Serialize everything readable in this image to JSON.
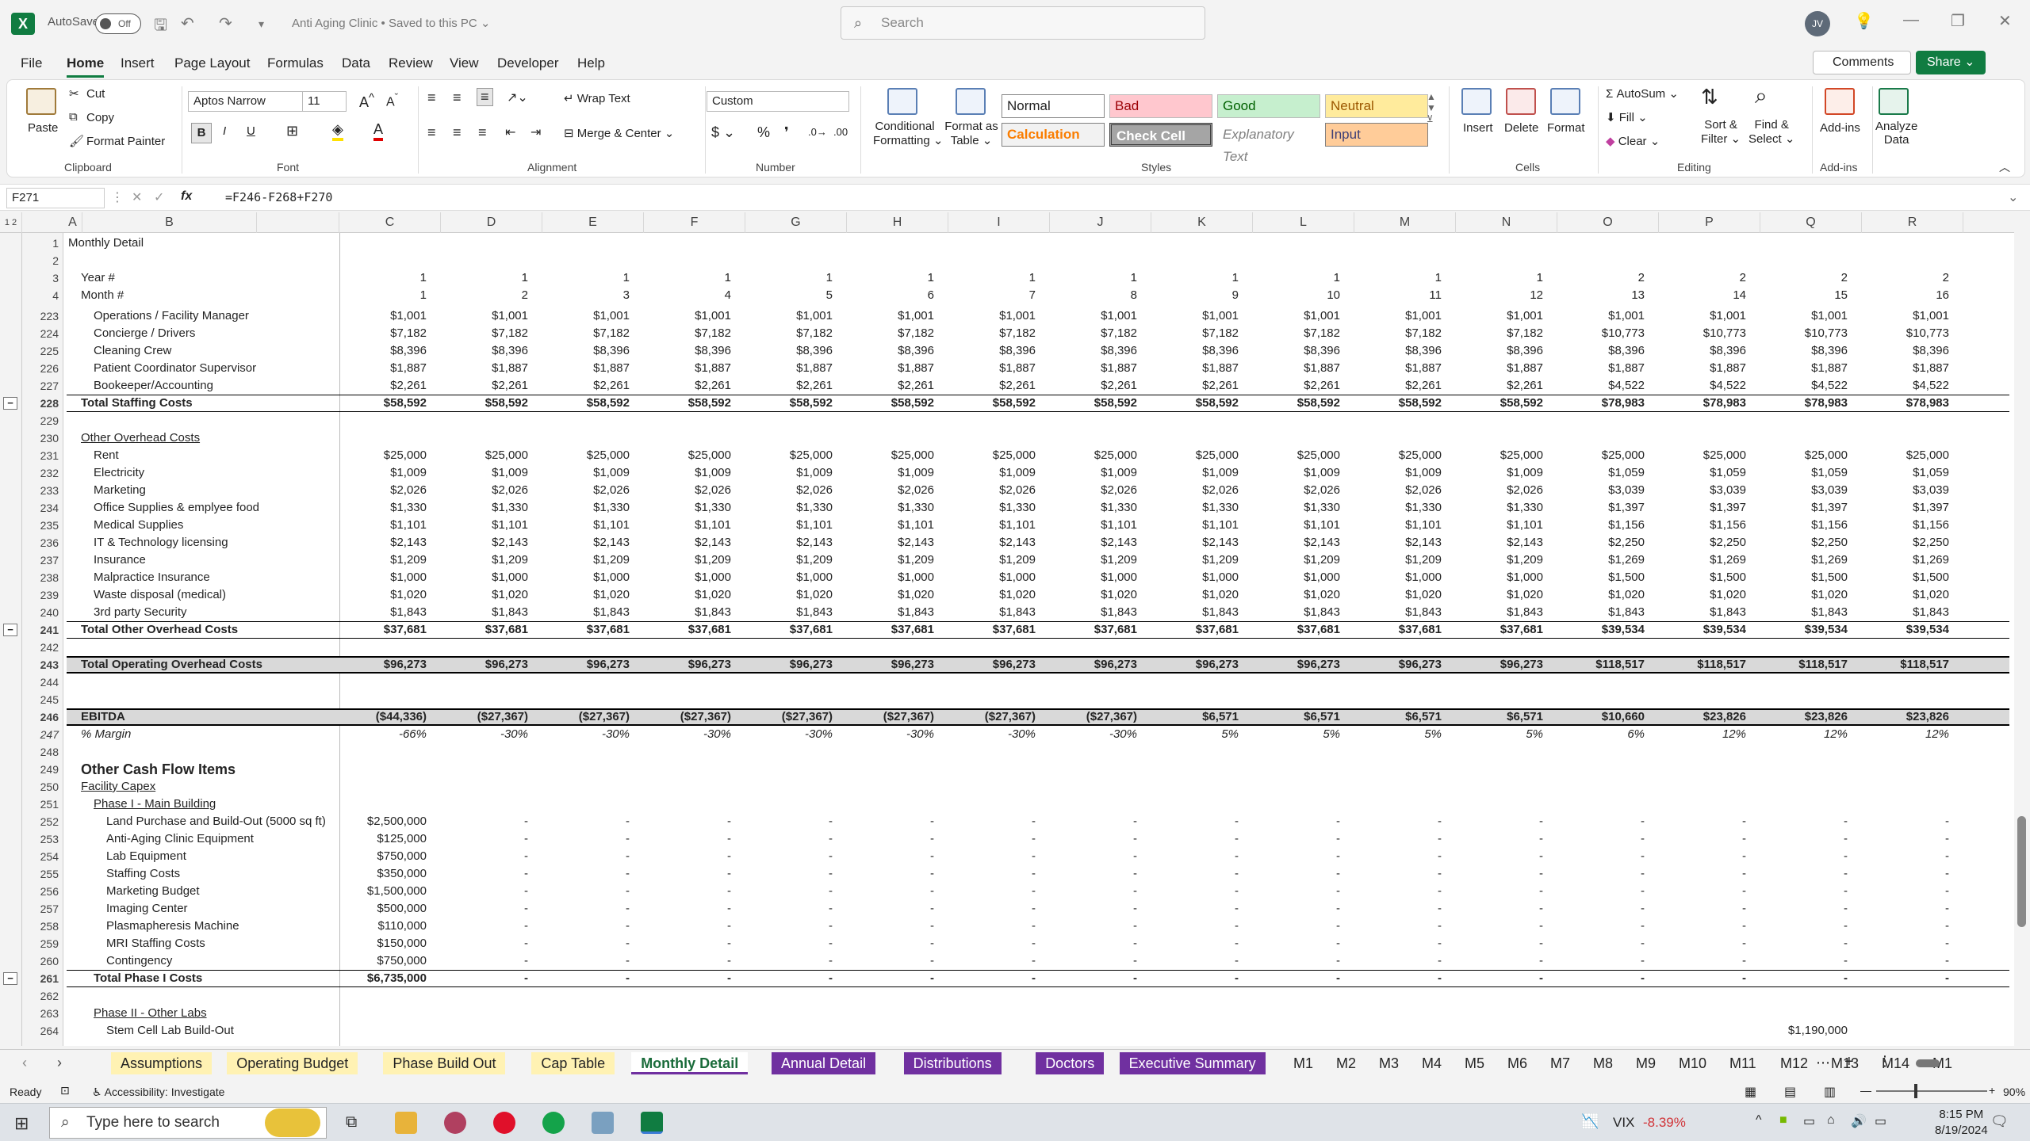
{
  "title": {
    "autosave": "AutoSave",
    "toggle": "Off",
    "doc": "Anti Aging Clinic • Saved to this PC ⌄",
    "search": "Search",
    "avatar": "JV"
  },
  "menu": [
    "File",
    "Home",
    "Insert",
    "Page Layout",
    "Formulas",
    "Data",
    "Review",
    "View",
    "Developer",
    "Help"
  ],
  "actions": {
    "comments": "Comments",
    "share": "Share ⌄"
  },
  "ribbon": {
    "paste": "Paste",
    "cut": "Cut",
    "copy": "Copy",
    "format_painter": "Format Painter",
    "clipboard": "Clipboard",
    "font_name": "Aptos Narrow",
    "font_size": "11",
    "font": "Font",
    "wrap_text": "Wrap Text",
    "merge_center": "Merge & Center",
    "alignment": "Alignment",
    "num_format": "Custom",
    "number": "Number",
    "conditional": "Conditional",
    "formatting": "Formatting ⌄",
    "format_as": "Format as",
    "table": "Table ⌄",
    "styles": "Styles",
    "normal": "Normal",
    "bad": "Bad",
    "good": "Good",
    "neutral": "Neutral",
    "calculation": "Calculation",
    "check_cell": "Check Cell",
    "explanatory": "Explanatory Text",
    "input": "Input",
    "insert": "Insert",
    "delete": "Delete",
    "format": "Format",
    "cells": "Cells",
    "autosum": "AutoSum",
    "fill": "Fill",
    "clear": "Clear",
    "sort": "Sort &",
    "filter": "Filter ⌄",
    "find": "Find &",
    "select": "Select ⌄",
    "editing": "Editing",
    "addins": "Add-ins",
    "addins_grp": "Add-ins",
    "analyze": "Analyze",
    "data": "Data"
  },
  "formula": {
    "namebox": "F271",
    "fx": "fx",
    "text": "=F246-F268+F270"
  },
  "columns": [
    "A",
    "B",
    "C",
    "D",
    "E",
    "F",
    "G",
    "H",
    "I",
    "J",
    "K",
    "L",
    "M",
    "N",
    "O",
    "P",
    "Q",
    "R"
  ],
  "rows": [
    {
      "n": "1",
      "label": "Monthly Detail",
      "ind": 0,
      "style": "bold",
      "vals": []
    },
    {
      "n": "2",
      "label": "",
      "ind": 0,
      "style": "",
      "vals": []
    },
    {
      "n": "3",
      "label": "Year #",
      "ind": 1,
      "style": "",
      "vals": [
        "1",
        "1",
        "1",
        "1",
        "1",
        "1",
        "1",
        "1",
        "1",
        "1",
        "1",
        "1",
        "2",
        "2",
        "2",
        "2"
      ]
    },
    {
      "n": "4",
      "label": "Month #",
      "ind": 1,
      "style": "",
      "vals": [
        "1",
        "2",
        "3",
        "4",
        "5",
        "6",
        "7",
        "8",
        "9",
        "10",
        "11",
        "12",
        "13",
        "14",
        "15",
        "16"
      ]
    },
    {
      "n": "223",
      "label": "Operations / Facility Manager",
      "ind": 2,
      "style": "",
      "vals": [
        "$1,001",
        "$1,001",
        "$1,001",
        "$1,001",
        "$1,001",
        "$1,001",
        "$1,001",
        "$1,001",
        "$1,001",
        "$1,001",
        "$1,001",
        "$1,001",
        "$1,001",
        "$1,001",
        "$1,001",
        "$1,001"
      ]
    },
    {
      "n": "224",
      "label": "Concierge / Drivers",
      "ind": 2,
      "style": "",
      "vals": [
        "$7,182",
        "$7,182",
        "$7,182",
        "$7,182",
        "$7,182",
        "$7,182",
        "$7,182",
        "$7,182",
        "$7,182",
        "$7,182",
        "$7,182",
        "$7,182",
        "$10,773",
        "$10,773",
        "$10,773",
        "$10,773"
      ]
    },
    {
      "n": "225",
      "label": "Cleaning Crew",
      "ind": 2,
      "style": "",
      "vals": [
        "$8,396",
        "$8,396",
        "$8,396",
        "$8,396",
        "$8,396",
        "$8,396",
        "$8,396",
        "$8,396",
        "$8,396",
        "$8,396",
        "$8,396",
        "$8,396",
        "$8,396",
        "$8,396",
        "$8,396",
        "$8,396"
      ]
    },
    {
      "n": "226",
      "label": "Patient Coordinator Supervisor",
      "ind": 2,
      "style": "",
      "vals": [
        "$1,887",
        "$1,887",
        "$1,887",
        "$1,887",
        "$1,887",
        "$1,887",
        "$1,887",
        "$1,887",
        "$1,887",
        "$1,887",
        "$1,887",
        "$1,887",
        "$1,887",
        "$1,887",
        "$1,887",
        "$1,887"
      ]
    },
    {
      "n": "227",
      "label": "Bookeeper/Accounting",
      "ind": 2,
      "style": "",
      "vals": [
        "$2,261",
        "$2,261",
        "$2,261",
        "$2,261",
        "$2,261",
        "$2,261",
        "$2,261",
        "$2,261",
        "$2,261",
        "$2,261",
        "$2,261",
        "$2,261",
        "$4,522",
        "$4,522",
        "$4,522",
        "$4,522"
      ]
    },
    {
      "n": "228",
      "label": "Total Staffing Costs",
      "ind": 1,
      "style": "total",
      "vals": [
        "$58,592",
        "$58,592",
        "$58,592",
        "$58,592",
        "$58,592",
        "$58,592",
        "$58,592",
        "$58,592",
        "$58,592",
        "$58,592",
        "$58,592",
        "$58,592",
        "$78,983",
        "$78,983",
        "$78,983",
        "$78,983"
      ]
    },
    {
      "n": "229",
      "label": "",
      "ind": 0,
      "style": "",
      "vals": []
    },
    {
      "n": "230",
      "label": "Other Overhead Costs",
      "ind": 1,
      "style": "under",
      "vals": []
    },
    {
      "n": "231",
      "label": "Rent",
      "ind": 2,
      "style": "",
      "vals": [
        "$25,000",
        "$25,000",
        "$25,000",
        "$25,000",
        "$25,000",
        "$25,000",
        "$25,000",
        "$25,000",
        "$25,000",
        "$25,000",
        "$25,000",
        "$25,000",
        "$25,000",
        "$25,000",
        "$25,000",
        "$25,000"
      ]
    },
    {
      "n": "232",
      "label": "Electricity",
      "ind": 2,
      "style": "",
      "vals": [
        "$1,009",
        "$1,009",
        "$1,009",
        "$1,009",
        "$1,009",
        "$1,009",
        "$1,009",
        "$1,009",
        "$1,009",
        "$1,009",
        "$1,009",
        "$1,009",
        "$1,059",
        "$1,059",
        "$1,059",
        "$1,059"
      ]
    },
    {
      "n": "233",
      "label": "Marketing",
      "ind": 2,
      "style": "",
      "vals": [
        "$2,026",
        "$2,026",
        "$2,026",
        "$2,026",
        "$2,026",
        "$2,026",
        "$2,026",
        "$2,026",
        "$2,026",
        "$2,026",
        "$2,026",
        "$2,026",
        "$3,039",
        "$3,039",
        "$3,039",
        "$3,039"
      ]
    },
    {
      "n": "234",
      "label": "Office Supplies & emplyee food",
      "ind": 2,
      "style": "",
      "vals": [
        "$1,330",
        "$1,330",
        "$1,330",
        "$1,330",
        "$1,330",
        "$1,330",
        "$1,330",
        "$1,330",
        "$1,330",
        "$1,330",
        "$1,330",
        "$1,330",
        "$1,397",
        "$1,397",
        "$1,397",
        "$1,397"
      ]
    },
    {
      "n": "235",
      "label": "Medical Supplies",
      "ind": 2,
      "style": "",
      "vals": [
        "$1,101",
        "$1,101",
        "$1,101",
        "$1,101",
        "$1,101",
        "$1,101",
        "$1,101",
        "$1,101",
        "$1,101",
        "$1,101",
        "$1,101",
        "$1,101",
        "$1,156",
        "$1,156",
        "$1,156",
        "$1,156"
      ]
    },
    {
      "n": "236",
      "label": "IT & Technology licensing",
      "ind": 2,
      "style": "",
      "vals": [
        "$2,143",
        "$2,143",
        "$2,143",
        "$2,143",
        "$2,143",
        "$2,143",
        "$2,143",
        "$2,143",
        "$2,143",
        "$2,143",
        "$2,143",
        "$2,143",
        "$2,250",
        "$2,250",
        "$2,250",
        "$2,250"
      ]
    },
    {
      "n": "237",
      "label": "Insurance",
      "ind": 2,
      "style": "",
      "vals": [
        "$1,209",
        "$1,209",
        "$1,209",
        "$1,209",
        "$1,209",
        "$1,209",
        "$1,209",
        "$1,209",
        "$1,209",
        "$1,209",
        "$1,209",
        "$1,209",
        "$1,269",
        "$1,269",
        "$1,269",
        "$1,269"
      ]
    },
    {
      "n": "238",
      "label": "Malpractice Insurance",
      "ind": 2,
      "style": "",
      "vals": [
        "$1,000",
        "$1,000",
        "$1,000",
        "$1,000",
        "$1,000",
        "$1,000",
        "$1,000",
        "$1,000",
        "$1,000",
        "$1,000",
        "$1,000",
        "$1,000",
        "$1,500",
        "$1,500",
        "$1,500",
        "$1,500"
      ]
    },
    {
      "n": "239",
      "label": "Waste disposal (medical)",
      "ind": 2,
      "style": "",
      "vals": [
        "$1,020",
        "$1,020",
        "$1,020",
        "$1,020",
        "$1,020",
        "$1,020",
        "$1,020",
        "$1,020",
        "$1,020",
        "$1,020",
        "$1,020",
        "$1,020",
        "$1,020",
        "$1,020",
        "$1,020",
        "$1,020"
      ]
    },
    {
      "n": "240",
      "label": "3rd party Security",
      "ind": 2,
      "style": "",
      "vals": [
        "$1,843",
        "$1,843",
        "$1,843",
        "$1,843",
        "$1,843",
        "$1,843",
        "$1,843",
        "$1,843",
        "$1,843",
        "$1,843",
        "$1,843",
        "$1,843",
        "$1,843",
        "$1,843",
        "$1,843",
        "$1,843"
      ]
    },
    {
      "n": "241",
      "label": "Total Other Overhead Costs",
      "ind": 1,
      "style": "total",
      "vals": [
        "$37,681",
        "$37,681",
        "$37,681",
        "$37,681",
        "$37,681",
        "$37,681",
        "$37,681",
        "$37,681",
        "$37,681",
        "$37,681",
        "$37,681",
        "$37,681",
        "$39,534",
        "$39,534",
        "$39,534",
        "$39,534"
      ]
    },
    {
      "n": "242",
      "label": "",
      "ind": 0,
      "style": "",
      "vals": []
    },
    {
      "n": "243",
      "label": "Total Operating Overhead Costs",
      "ind": 1,
      "style": "total shade",
      "vals": [
        "$96,273",
        "$96,273",
        "$96,273",
        "$96,273",
        "$96,273",
        "$96,273",
        "$96,273",
        "$96,273",
        "$96,273",
        "$96,273",
        "$96,273",
        "$96,273",
        "$118,517",
        "$118,517",
        "$118,517",
        "$118,517"
      ]
    },
    {
      "n": "244",
      "label": "",
      "ind": 0,
      "style": "",
      "vals": []
    },
    {
      "n": "245",
      "label": "",
      "ind": 0,
      "style": "",
      "vals": []
    },
    {
      "n": "246",
      "label": "EBITDA",
      "ind": 1,
      "style": "total shade",
      "vals": [
        "($44,336)",
        "($27,367)",
        "($27,367)",
        "($27,367)",
        "($27,367)",
        "($27,367)",
        "($27,367)",
        "($27,367)",
        "$6,571",
        "$6,571",
        "$6,571",
        "$6,571",
        "$10,660",
        "$23,826",
        "$23,826",
        "$23,826"
      ]
    },
    {
      "n": "247",
      "label": "% Margin",
      "ind": 1,
      "style": "ital",
      "vals": [
        "-66%",
        "-30%",
        "-30%",
        "-30%",
        "-30%",
        "-30%",
        "-30%",
        "-30%",
        "5%",
        "5%",
        "5%",
        "5%",
        "6%",
        "12%",
        "12%",
        "12%"
      ]
    },
    {
      "n": "248",
      "label": "",
      "ind": 0,
      "style": "",
      "vals": []
    },
    {
      "n": "249",
      "label": "Other Cash Flow Items",
      "ind": 1,
      "style": "big",
      "vals": []
    },
    {
      "n": "250",
      "label": "Facility Capex",
      "ind": 1,
      "style": "under",
      "vals": []
    },
    {
      "n": "251",
      "label": "Phase I - Main Building",
      "ind": 2,
      "style": "under",
      "vals": []
    },
    {
      "n": "252",
      "label": "Land Purchase and Build-Out (5000 sq ft)",
      "ind": 3,
      "style": "",
      "vals": [
        "$2,500,000",
        "-",
        "-",
        "-",
        "-",
        "-",
        "-",
        "-",
        "-",
        "-",
        "-",
        "-",
        "-",
        "-",
        "-",
        "-"
      ]
    },
    {
      "n": "253",
      "label": "Anti-Aging Clinic Equipment",
      "ind": 3,
      "style": "",
      "vals": [
        "$125,000",
        "-",
        "-",
        "-",
        "-",
        "-",
        "-",
        "-",
        "-",
        "-",
        "-",
        "-",
        "-",
        "-",
        "-",
        "-"
      ]
    },
    {
      "n": "254",
      "label": "Lab Equipment",
      "ind": 3,
      "style": "",
      "vals": [
        "$750,000",
        "-",
        "-",
        "-",
        "-",
        "-",
        "-",
        "-",
        "-",
        "-",
        "-",
        "-",
        "-",
        "-",
        "-",
        "-"
      ]
    },
    {
      "n": "255",
      "label": "Staffing Costs",
      "ind": 3,
      "style": "",
      "vals": [
        "$350,000",
        "-",
        "-",
        "-",
        "-",
        "-",
        "-",
        "-",
        "-",
        "-",
        "-",
        "-",
        "-",
        "-",
        "-",
        "-"
      ]
    },
    {
      "n": "256",
      "label": "Marketing Budget",
      "ind": 3,
      "style": "",
      "vals": [
        "$1,500,000",
        "-",
        "-",
        "-",
        "-",
        "-",
        "-",
        "-",
        "-",
        "-",
        "-",
        "-",
        "-",
        "-",
        "-",
        "-"
      ]
    },
    {
      "n": "257",
      "label": "Imaging Center",
      "ind": 3,
      "style": "",
      "vals": [
        "$500,000",
        "-",
        "-",
        "-",
        "-",
        "-",
        "-",
        "-",
        "-",
        "-",
        "-",
        "-",
        "-",
        "-",
        "-",
        "-"
      ]
    },
    {
      "n": "258",
      "label": "Plasmapheresis Machine",
      "ind": 3,
      "style": "",
      "vals": [
        "$110,000",
        "-",
        "-",
        "-",
        "-",
        "-",
        "-",
        "-",
        "-",
        "-",
        "-",
        "-",
        "-",
        "-",
        "-",
        "-"
      ]
    },
    {
      "n": "259",
      "label": "MRI Staffing Costs",
      "ind": 3,
      "style": "",
      "vals": [
        "$150,000",
        "-",
        "-",
        "-",
        "-",
        "-",
        "-",
        "-",
        "-",
        "-",
        "-",
        "-",
        "-",
        "-",
        "-",
        "-"
      ]
    },
    {
      "n": "260",
      "label": "Contingency",
      "ind": 3,
      "style": "",
      "vals": [
        "$750,000",
        "-",
        "-",
        "-",
        "-",
        "-",
        "-",
        "-",
        "-",
        "-",
        "-",
        "-",
        "-",
        "-",
        "-",
        "-"
      ]
    },
    {
      "n": "261",
      "label": "Total Phase I Costs",
      "ind": 2,
      "style": "total thin",
      "vals": [
        "$6,735,000",
        "-",
        "-",
        "-",
        "-",
        "-",
        "-",
        "-",
        "-",
        "-",
        "-",
        "-",
        "-",
        "-",
        "-",
        "-"
      ]
    },
    {
      "n": "262",
      "label": "",
      "ind": 0,
      "style": "",
      "vals": []
    },
    {
      "n": "263",
      "label": "Phase II - Other Labs",
      "ind": 2,
      "style": "under",
      "vals": []
    },
    {
      "n": "264",
      "label": "Stem Cell Lab Build-Out",
      "ind": 3,
      "style": "",
      "vals": [
        "",
        "",
        "",
        "",
        "",
        "",
        "",
        "",
        "",
        "",
        "",
        "",
        "",
        "",
        "$1,190,000",
        ""
      ]
    }
  ],
  "tabs": [
    {
      "label": "Assumptions",
      "kind": "y"
    },
    {
      "label": "Operating Budget",
      "kind": "y"
    },
    {
      "label": "Phase Build Out",
      "kind": "y"
    },
    {
      "label": "Cap Table",
      "kind": "y"
    },
    {
      "label": "Monthly Detail",
      "kind": "active"
    },
    {
      "label": "Annual Detail",
      "kind": "p"
    },
    {
      "label": "Distributions",
      "kind": "p"
    },
    {
      "label": "Doctors",
      "kind": "p"
    },
    {
      "label": "Executive Summary",
      "kind": "p"
    },
    {
      "label": "M1",
      "kind": ""
    },
    {
      "label": "M2",
      "kind": ""
    },
    {
      "label": "M3",
      "kind": ""
    },
    {
      "label": "M4",
      "kind": ""
    },
    {
      "label": "M5",
      "kind": ""
    },
    {
      "label": "M6",
      "kind": ""
    },
    {
      "label": "M7",
      "kind": ""
    },
    {
      "label": "M8",
      "kind": ""
    },
    {
      "label": "M9",
      "kind": ""
    },
    {
      "label": "M10",
      "kind": ""
    },
    {
      "label": "M11",
      "kind": ""
    },
    {
      "label": "M12",
      "kind": ""
    },
    {
      "label": "M13",
      "kind": ""
    },
    {
      "label": "M14",
      "kind": ""
    },
    {
      "label": "M1",
      "kind": ""
    }
  ],
  "status": {
    "ready": "Ready",
    "accessibility": "Accessibility: Investigate",
    "zoom": "90%"
  },
  "taskbar": {
    "search": "Type here to search",
    "vix": "VIX",
    "vix_change": "-8.39%",
    "time": "8:15 PM",
    "date": "8/19/2024"
  },
  "colors": {
    "excel_green": "#107c41",
    "tab_yellow": "#fff2b3",
    "tab_purple": "#7030a0",
    "neg_red": "#d13438"
  }
}
